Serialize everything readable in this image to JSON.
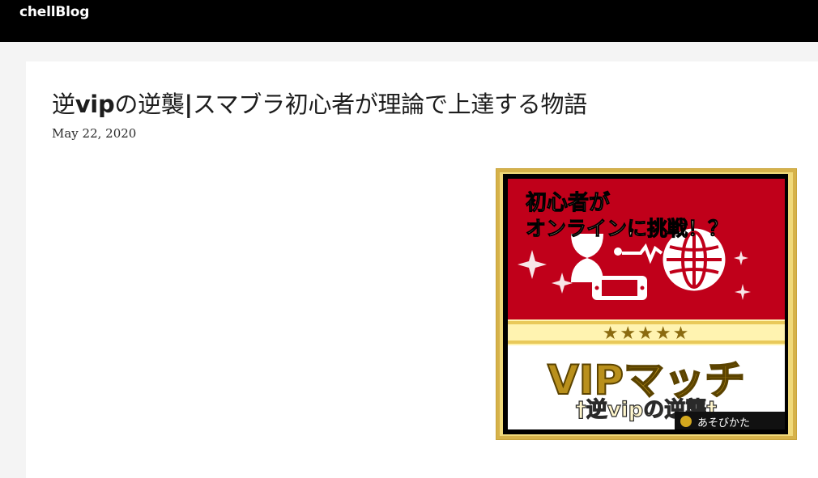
{
  "site": {
    "title": "chellBlog"
  },
  "post": {
    "title_part1": "逆",
    "title_bold": "vip",
    "title_part2": "の逆襲",
    "title_sep": "|",
    "title_part3": "スマブラ初心者が理論で上達する物語",
    "date": "May 22, 2020"
  },
  "thumbnail": {
    "line1": "初心者が",
    "line2": "オンラインに挑戦！？",
    "stars": "★★★★★",
    "main_text": "VIPマッチ",
    "sub_text": "†逆vipの逆襲†",
    "corner_text": "あそびかた",
    "colors": {
      "red": "#c0001a",
      "gold": "#d4a81e",
      "cream": "#fff3b0"
    }
  }
}
